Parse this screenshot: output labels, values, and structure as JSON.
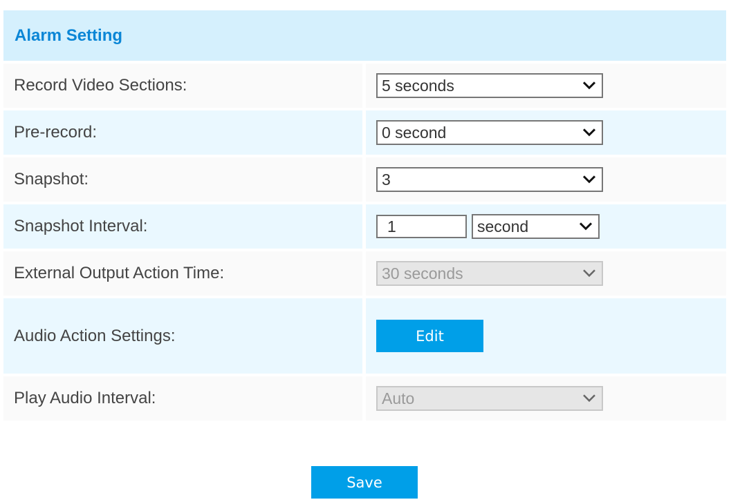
{
  "section": {
    "title": "Alarm Setting"
  },
  "rows": [
    {
      "label": "Record Video Sections:",
      "control": "select",
      "value": "5 seconds",
      "disabled": false
    },
    {
      "label": "Pre-record:",
      "control": "select",
      "value": "0 second",
      "disabled": false
    },
    {
      "label": "Snapshot:",
      "control": "select",
      "value": "3",
      "disabled": false
    },
    {
      "label": "Snapshot Interval:",
      "control": "input+select",
      "input_value": "1",
      "unit_value": "second",
      "disabled": false
    },
    {
      "label": "External Output Action Time:",
      "control": "select",
      "value": "30 seconds",
      "disabled": true
    },
    {
      "label": "Audio Action Settings:",
      "control": "button",
      "button_label": "Edit"
    },
    {
      "label": "Play Audio Interval:",
      "control": "select",
      "value": "Auto",
      "disabled": true
    }
  ],
  "footer": {
    "save_label": "Save"
  },
  "colors": {
    "accent": "#009fe8",
    "title": "#0b86d6",
    "header_bg": "#d5f0fd"
  },
  "icons": {
    "dropdown": "chevron-down-icon"
  }
}
